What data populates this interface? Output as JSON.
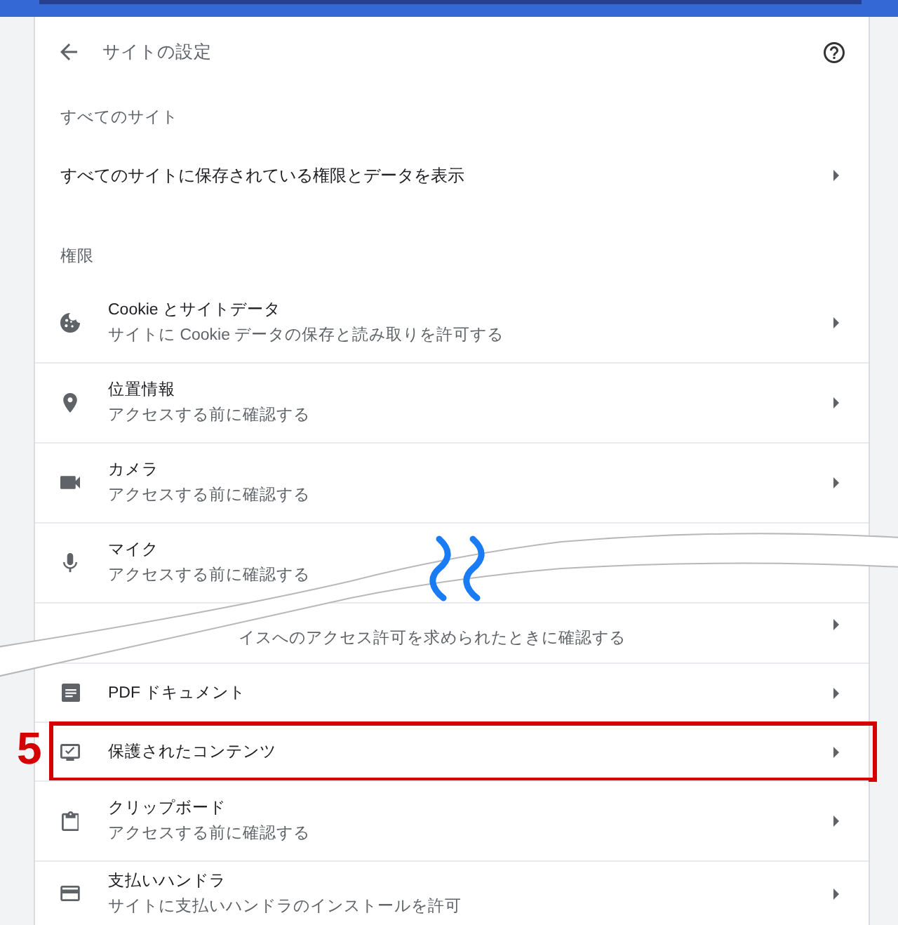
{
  "header": {
    "title": "サイトの設定"
  },
  "sections": [
    {
      "label": "すべてのサイト",
      "rows": [
        {
          "kind": "link",
          "title": "すべてのサイトに保存されている権限とデータを表示",
          "arrow": true
        }
      ]
    },
    {
      "label": "権限",
      "rows": [
        {
          "kind": "item",
          "title": "Cookie とサイトデータ",
          "subtitle": "サイトに Cookie データの保存と読み取りを許可する",
          "arrow": true
        },
        {
          "kind": "item",
          "title": "位置情報",
          "subtitle": "アクセスする前に確認する",
          "arrow": true
        },
        {
          "kind": "item",
          "title": "カメラ",
          "subtitle": "アクセスする前に確認する",
          "arrow": true
        },
        {
          "kind": "item",
          "title": "マイク",
          "subtitle": "アクセスする前に確認する",
          "arrow": false
        },
        {
          "kind": "partial",
          "subtitle": "イスへのアクセス許可を求められたときに確認する",
          "arrow": true
        },
        {
          "kind": "item",
          "title": "PDF ドキュメント",
          "arrow": true
        },
        {
          "kind": "item",
          "title": "保護されたコンテンツ",
          "arrow": true,
          "callout": "5"
        },
        {
          "kind": "item",
          "title": "クリップボード",
          "subtitle": "アクセスする前に確認する",
          "arrow": true
        },
        {
          "kind": "item",
          "title": "支払いハンドラ",
          "subtitle": "サイトに支払いハンドラのインストールを許可",
          "arrow": true
        }
      ]
    }
  ]
}
